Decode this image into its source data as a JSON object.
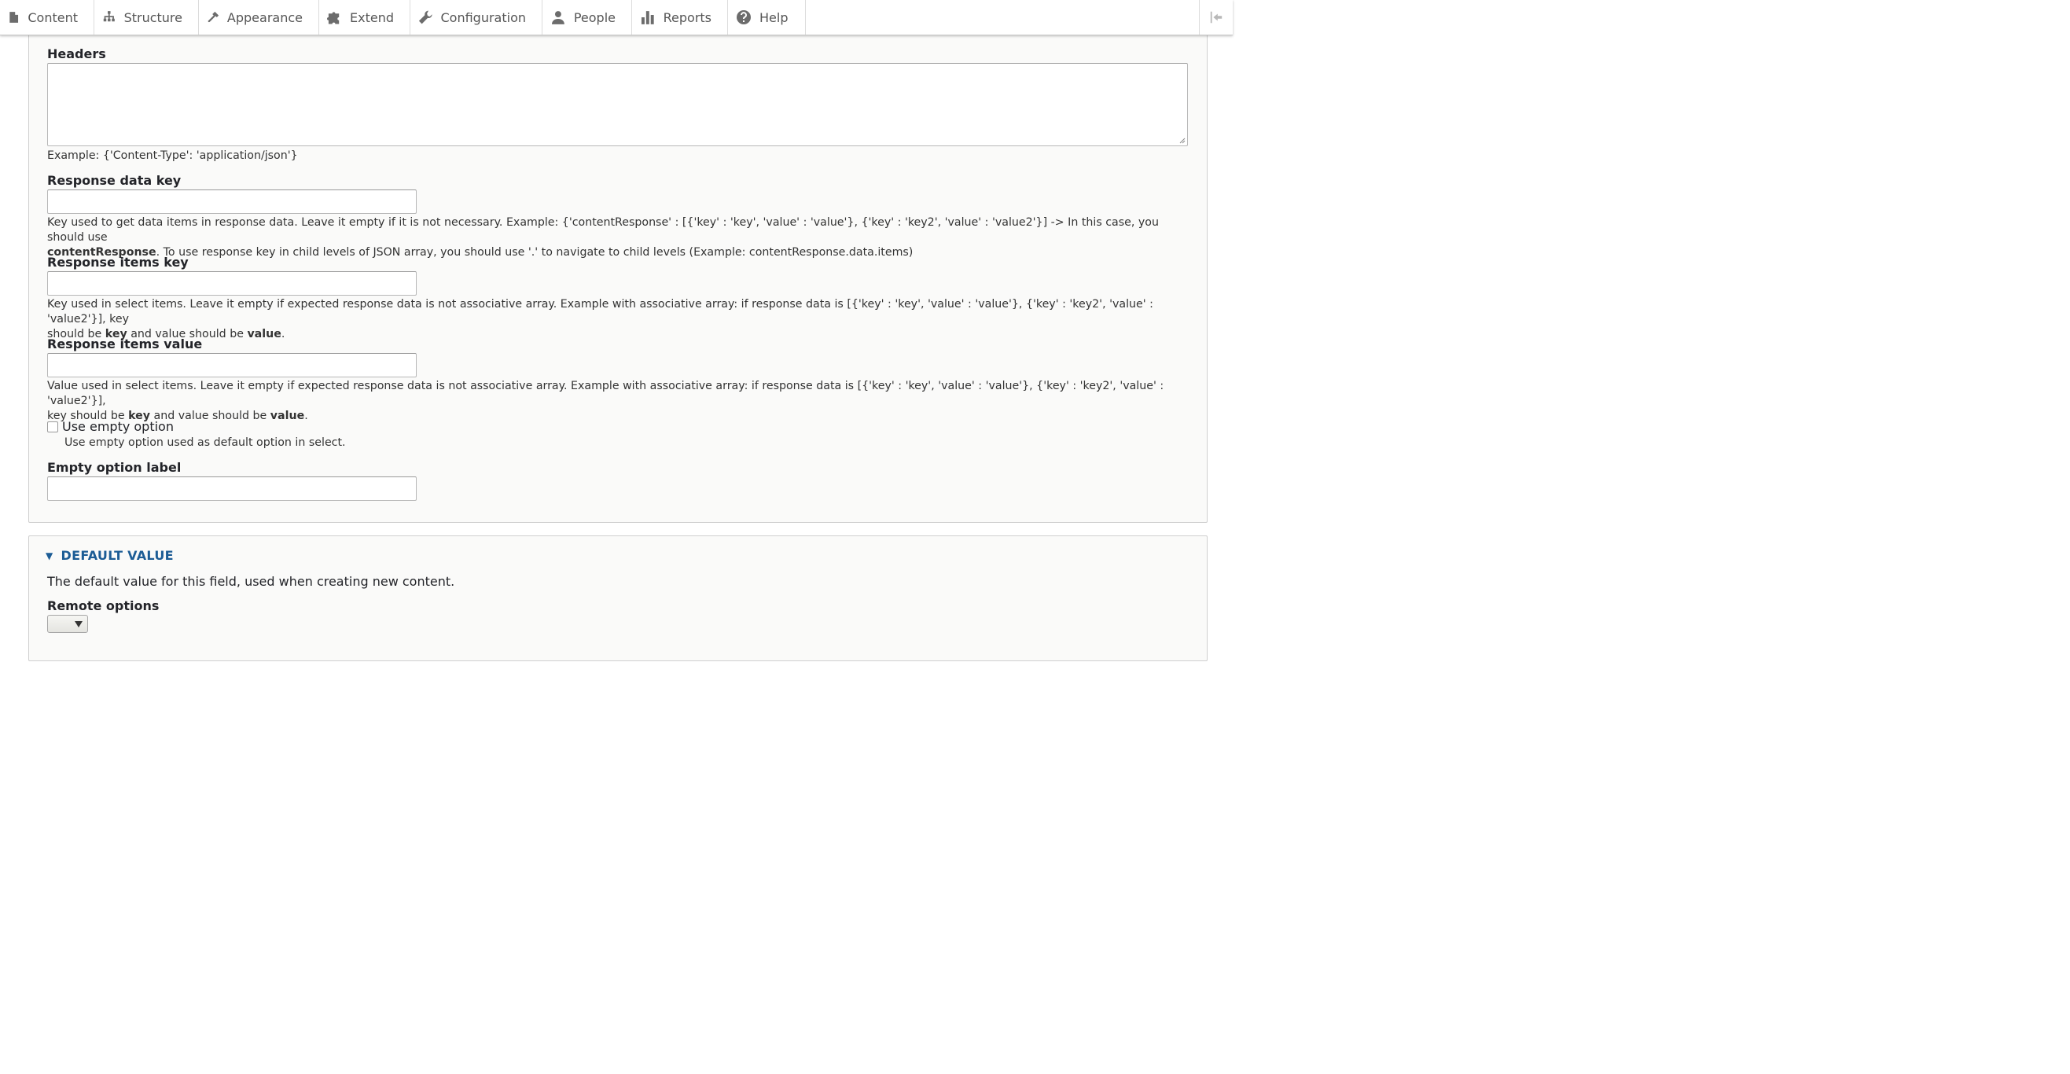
{
  "toolbar": {
    "items": [
      {
        "label": "Content",
        "icon": "file-icon"
      },
      {
        "label": "Structure",
        "icon": "sitemap-icon"
      },
      {
        "label": "Appearance",
        "icon": "paintbrush-icon"
      },
      {
        "label": "Extend",
        "icon": "puzzle-icon"
      },
      {
        "label": "Configuration",
        "icon": "wrench-icon"
      },
      {
        "label": "People",
        "icon": "person-icon"
      },
      {
        "label": "Reports",
        "icon": "bar-chart-icon"
      },
      {
        "label": "Help",
        "icon": "help-icon"
      }
    ],
    "toggle_icon": "collapse-arrow-icon"
  },
  "form": {
    "headers": {
      "label": "Headers",
      "value": "",
      "description": "Example: {'Content-Type': 'application/json'}"
    },
    "response_data_key": {
      "label": "Response data key",
      "value": "",
      "desc_line1": "Key used to get data items in response data. Leave it empty if it is not necessary. Example: {'contentResponse' : [{'key' : 'key', 'value' : 'value'}, {'key' : 'key2', 'value' : 'value2'}] -> In this case, you should use",
      "desc_bold": "contentResponse",
      "desc_rest": ". To use response key in child levels of JSON array, you should use '.' to navigate to child levels (Example: contentResponse.data.items)"
    },
    "response_items_key": {
      "label": "Response items key",
      "value": "",
      "desc_line1": "Key used in select items. Leave it empty if expected response data is not associative array. Example with associative array: if response data is [{'key' : 'key', 'value' : 'value'}, {'key' : 'key2', 'value' : 'value2'}], key",
      "desc_pre": "should be ",
      "desc_bold1": "key",
      "desc_mid": " and value should be ",
      "desc_bold2": "value",
      "desc_end": "."
    },
    "response_items_value": {
      "label": "Response items value",
      "value": "",
      "desc_line1": "Value used in select items. Leave it empty if expected response data is not associative array. Example with associative array: if response data is [{'key' : 'key', 'value' : 'value'}, {'key' : 'key2', 'value' : 'value2'}],",
      "desc_pre": "key should be ",
      "desc_bold1": "key",
      "desc_mid": " and value should be ",
      "desc_bold2": "value",
      "desc_end": "."
    },
    "use_empty_option": {
      "label": "Use empty option",
      "checked": false,
      "description": "Use empty option used as default option in select."
    },
    "empty_option_label": {
      "label": "Empty option label",
      "value": ""
    }
  },
  "default_value": {
    "summary": "DEFAULT VALUE",
    "description": "The default value for this field, used when creating new content.",
    "remote_options": {
      "label": "Remote options",
      "selected": ""
    }
  },
  "colors": {
    "link_blue": "#1c5c95",
    "fieldset_bg": "#fafaf9"
  }
}
